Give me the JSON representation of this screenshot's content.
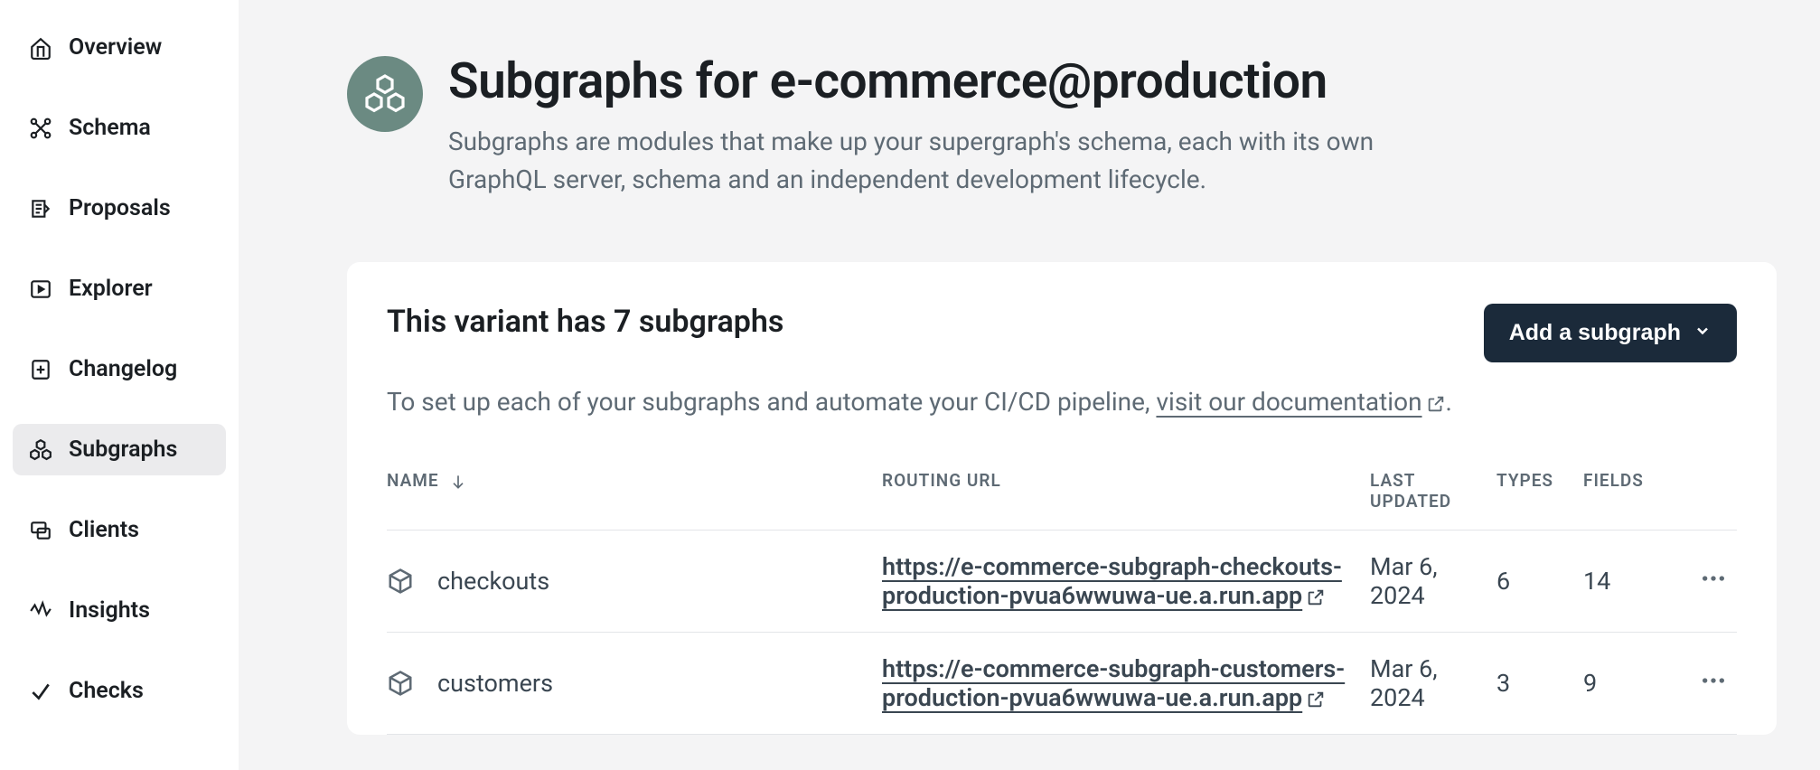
{
  "sidebar": {
    "items": [
      {
        "label": "Overview"
      },
      {
        "label": "Schema"
      },
      {
        "label": "Proposals"
      },
      {
        "label": "Explorer"
      },
      {
        "label": "Changelog"
      },
      {
        "label": "Subgraphs"
      },
      {
        "label": "Clients"
      },
      {
        "label": "Insights"
      },
      {
        "label": "Checks"
      }
    ]
  },
  "header": {
    "title": "Subgraphs for e-commerce@production",
    "subtitle": "Subgraphs are modules that make up your supergraph's schema, each with its own GraphQL server, schema and an independent development lifecycle."
  },
  "card": {
    "title": "This variant has 7 subgraphs",
    "add_button": "Add a subgraph",
    "desc_prefix": "To set up each of your subgraphs and automate your CI/CD pipeline, ",
    "doc_link": "visit our documentation",
    "desc_suffix": "."
  },
  "table": {
    "columns": {
      "name": "NAME",
      "url": "ROUTING URL",
      "updated": "LAST UPDATED",
      "types": "TYPES",
      "fields": "FIELDS"
    },
    "rows": [
      {
        "name": "checkouts",
        "url": "https://e-commerce-subgraph-checkouts-production-pvua6wwuwa-ue.a.run.app",
        "updated": "Mar 6, 2024",
        "types": "6",
        "fields": "14"
      },
      {
        "name": "customers",
        "url": "https://e-commerce-subgraph-customers-production-pvua6wwuwa-ue.a.run.app",
        "updated": "Mar 6, 2024",
        "types": "3",
        "fields": "9"
      }
    ]
  }
}
